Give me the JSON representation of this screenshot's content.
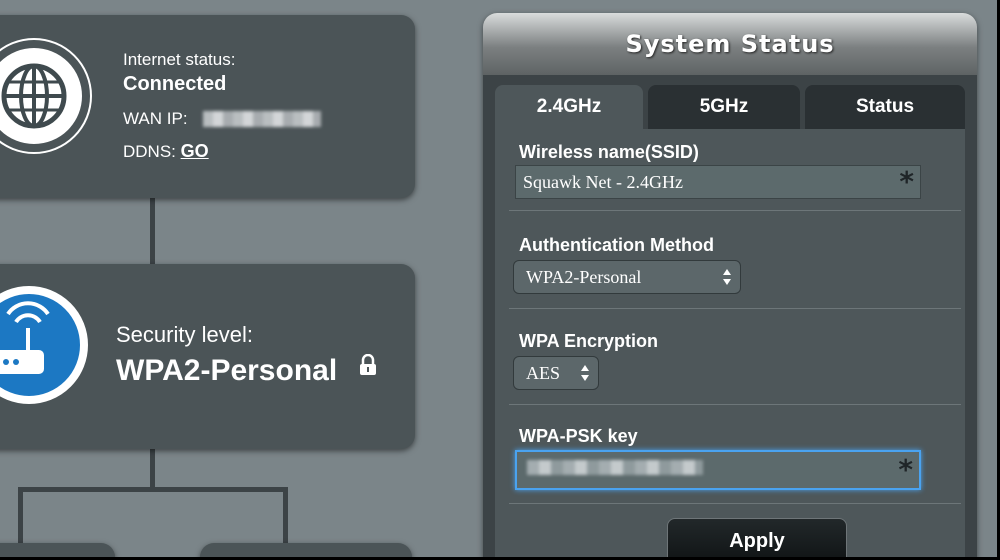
{
  "internet": {
    "status_label": "Internet status:",
    "status_value": "Connected",
    "wan_label": "WAN IP:",
    "ddns_label": "DDNS:",
    "ddns_link": "GO"
  },
  "security": {
    "label": "Security level:",
    "value": "WPA2-Personal"
  },
  "system_status": {
    "title": "System Status",
    "tabs": [
      {
        "label": "2.4GHz",
        "active": true
      },
      {
        "label": "5GHz",
        "active": false
      },
      {
        "label": "Status",
        "active": false
      }
    ],
    "ssid_label": "Wireless name(SSID)",
    "ssid_value": "Squawk Net - 2.4GHz",
    "auth_label": "Authentication Method",
    "auth_value": "WPA2-Personal",
    "encryption_label": "WPA Encryption",
    "encryption_value": "AES",
    "psk_label": "WPA-PSK key",
    "required_mark": "*",
    "apply_label": "Apply"
  },
  "icons": [
    "globe-icon",
    "router-icon",
    "lock-icon",
    "select-arrows-icon"
  ],
  "colors": {
    "background": "#7b8589",
    "card": "#4b5457",
    "panel": "#3c4346",
    "focus": "#4aa3f0"
  }
}
